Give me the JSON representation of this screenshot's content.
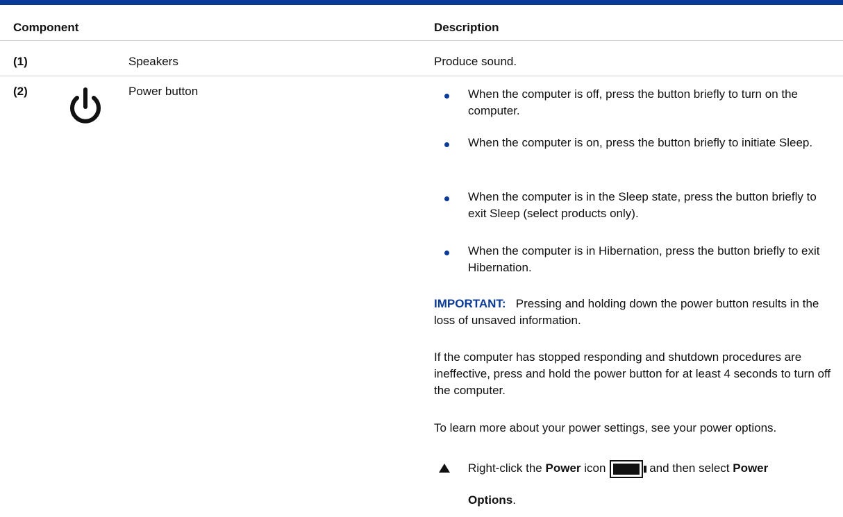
{
  "table": {
    "headers": {
      "component": "Component",
      "description": "Description"
    },
    "rows": [
      {
        "number": "(1)",
        "name": "Speakers",
        "description": "Produce sound."
      },
      {
        "number": "(2)",
        "name": "Power button",
        "icon": "power-icon",
        "bullets": [
          "When the computer is off, press the button briefly to turn on the computer.",
          "When the computer is on, press the button briefly to initiate Sleep.",
          "When the computer is in the Sleep state, press the button briefly to exit Sleep (select products only).",
          "When the computer is in Hibernation, press the button briefly to exit Hibernation."
        ],
        "important_label": "IMPORTANT:",
        "important_text": "Pressing and holding down the power button results in the loss of unsaved information.",
        "paragraph_1": "If the computer has stopped responding and shutdown procedures are ineffective, press and hold the power button for at least 4 seconds to turn off the computer.",
        "paragraph_2": "To learn more about your power settings, see your power options.",
        "step": {
          "prefix": "Right-click the",
          "kw1": "Power",
          "mid": "icon",
          "icon": "battery-icon",
          "suffix": "and then select",
          "kw2": "Power",
          "kw3": "Options",
          "end": "."
        }
      }
    ]
  },
  "colors": {
    "accent": "#0a3a97",
    "divider": "#cfcfcf",
    "text": "#111111"
  }
}
